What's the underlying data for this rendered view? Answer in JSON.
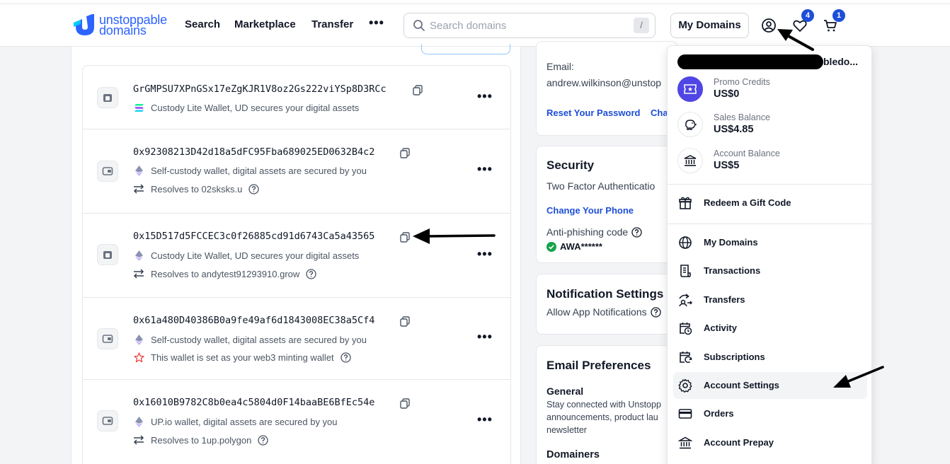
{
  "header": {
    "logo": {
      "line1": "unstoppable",
      "line2": "domains"
    },
    "nav": {
      "search": "Search",
      "marketplace": "Marketplace",
      "transfer": "Transfer",
      "more": "•••"
    },
    "search": {
      "placeholder": "Search domains",
      "shortcut": "/"
    },
    "my_domains_label": "My Domains",
    "favorites_count": "4",
    "cart_count": "1"
  },
  "wallets": [
    {
      "address": "GrGMPSU7XPnGSx17eZgKJR1V8oz2Gs222viYSp8D3RCc",
      "type_text": "Custody Lite Wallet, UD secures your digital assets",
      "type_icon": "solana-icon",
      "extra": null
    },
    {
      "address": "0x92308213D42d18a5dFC95Fba689025ED0632B4c2",
      "type_text": "Self-custody wallet, digital assets are secured by you",
      "type_icon": "ethereum-icon",
      "extra": {
        "icon": "swap-arrows-icon",
        "text": "Resolves to 02sksks.u"
      }
    },
    {
      "address": "0x15D517d5FCCEC3c0f26885cd91d6743Ca5a43565",
      "type_text": "Custody Lite Wallet, UD secures your digital assets",
      "type_icon": "ethereum-icon",
      "extra": {
        "icon": "swap-arrows-icon",
        "text": "Resolves to andytest91293910.grow"
      }
    },
    {
      "address": "0x61a480D40386B0a9fe49af6d1843008EC38a5Cf4",
      "type_text": "Self-custody wallet, digital assets are secured by you",
      "type_icon": "ethereum-icon",
      "extra": {
        "icon": "star-icon",
        "text": "This wallet is set as your web3 minting wallet"
      }
    },
    {
      "address": "0x16010B9782C8b0ea4c5804d0F14baaBE6BfEc54e",
      "type_text": "UP.io wallet, digital assets are secured by you",
      "type_icon": "ethereum-icon",
      "extra": {
        "icon": "swap-arrows-icon",
        "text": "Resolves to 1up.polygon"
      }
    }
  ],
  "account": {
    "email_label": "Email:",
    "email_value": "andrew.wilkinson@unstop",
    "reset_password": "Reset Your Password",
    "change_partial": "Cha"
  },
  "security": {
    "title": "Security",
    "two_factor": "Two Factor Authenticatio",
    "change_phone": "Change Your Phone",
    "anti_phishing_label": "Anti-phishing code",
    "anti_phishing_value": "AWA******"
  },
  "notifications": {
    "title": "Notification Settings",
    "allow_app": "Allow App Notifications"
  },
  "email_prefs": {
    "title": "Email Preferences",
    "general_title": "General",
    "general_line1": "Stay connected with Unstopp",
    "general_line2": "announcements, product lau",
    "general_line3": "newsletter",
    "domainers_title": "Domainers"
  },
  "dropdown": {
    "username_tail": "bledo...",
    "balances": [
      {
        "label": "Promo Credits",
        "value": "US$0",
        "icon": "promo-ticket-icon"
      },
      {
        "label": "Sales Balance",
        "value": "US$4.85",
        "icon": "piggy-bank-icon"
      },
      {
        "label": "Account Balance",
        "value": "US$5",
        "icon": "bank-icon"
      }
    ],
    "gift": "Redeem a Gift Code",
    "menu": [
      {
        "label": "My Domains",
        "icon": "globe-icon"
      },
      {
        "label": "Transactions",
        "icon": "receipt-icon"
      },
      {
        "label": "Transfers",
        "icon": "transfer-icon"
      },
      {
        "label": "Activity",
        "icon": "calendar-clock-icon"
      },
      {
        "label": "Subscriptions",
        "icon": "calendar-refresh-icon"
      },
      {
        "label": "Account Settings",
        "icon": "gear-icon"
      },
      {
        "label": "Orders",
        "icon": "card-icon"
      },
      {
        "label": "Account Prepay",
        "icon": "bank-icon"
      }
    ]
  },
  "colors": {
    "brand": "#2d64ff",
    "link": "#1d4ed8",
    "badge": "#1d4ed8",
    "success": "#16a34a",
    "star": "#ef4444"
  }
}
